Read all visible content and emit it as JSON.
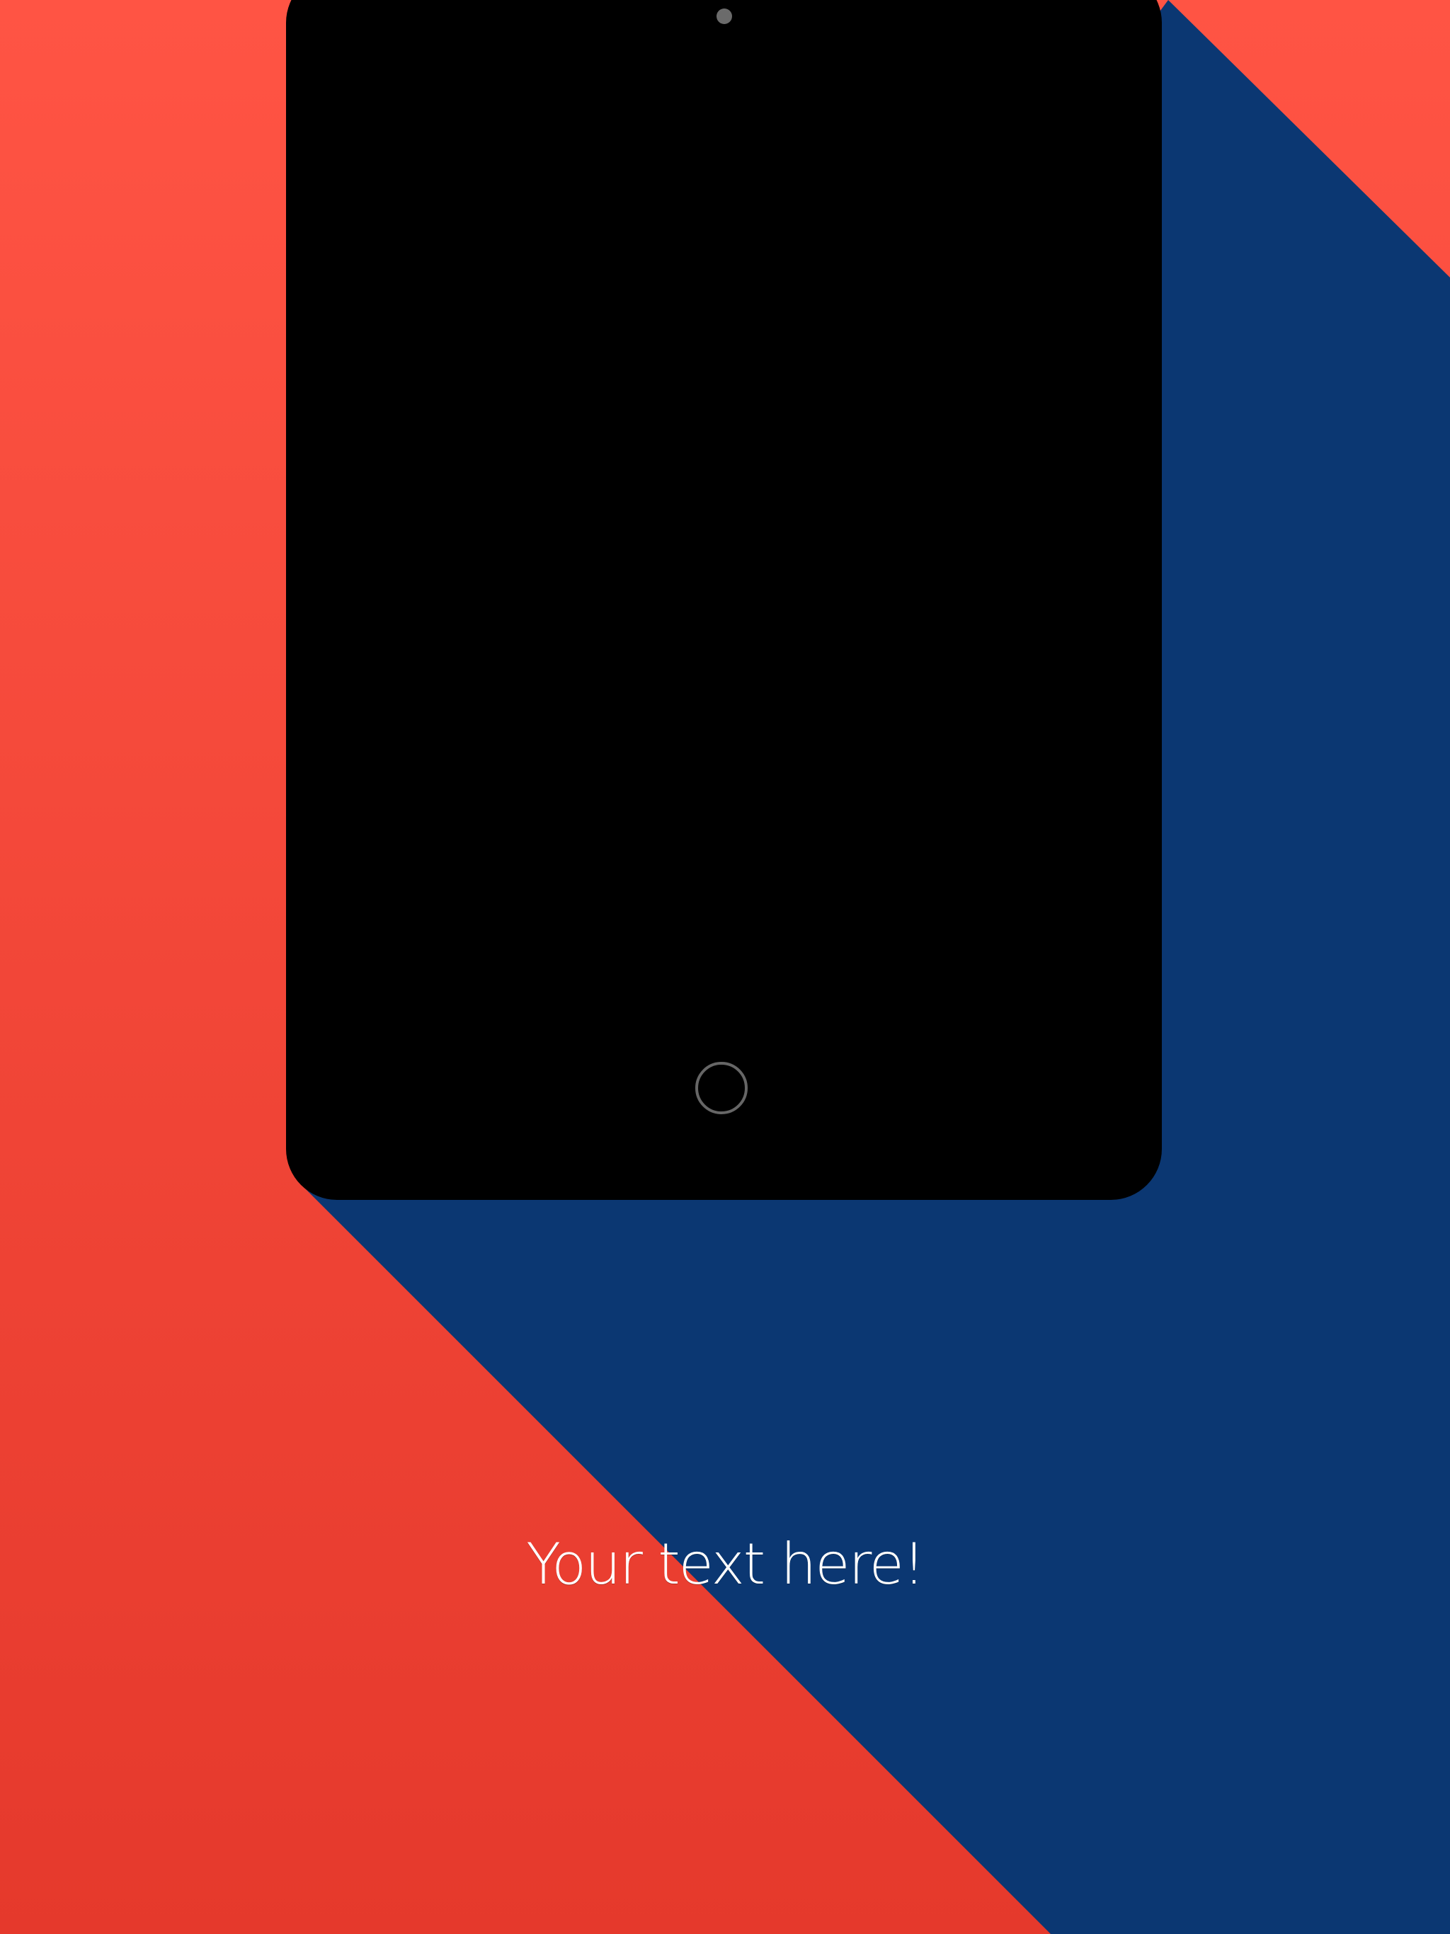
{
  "caption": {
    "text": "Your text here!"
  },
  "colors": {
    "gradient_top": "#ff5444",
    "gradient_bottom": "#e5392c",
    "diagonal_band": "#0b3772",
    "tablet_body": "#000000",
    "camera": "#6b6b6b",
    "home_button_ring": "#666666",
    "caption_text": "#ffffff"
  }
}
